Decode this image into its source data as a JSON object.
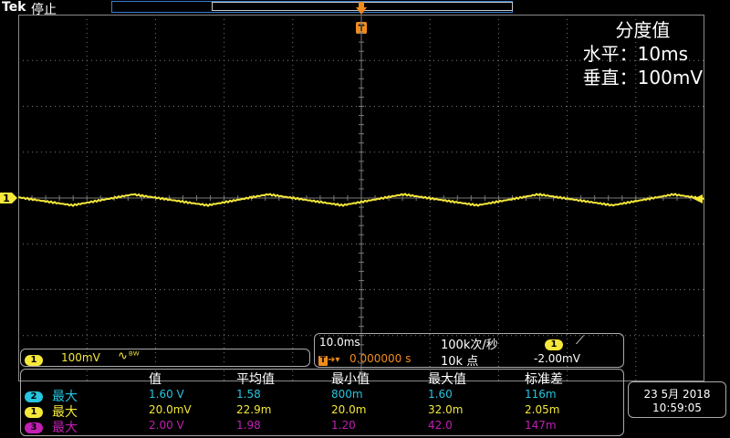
{
  "header": {
    "brand": "Tek",
    "acq_state": "停止"
  },
  "scale_box": {
    "title": "分度值",
    "horizontal_label": "水平：",
    "horizontal_value": "10ms",
    "vertical_label": "垂直：",
    "vertical_value": "100mV"
  },
  "markers": {
    "trigger_letter": "T",
    "channel1": "1"
  },
  "channel_bar": {
    "channel": "1",
    "scale": "100mV",
    "coupling_icon": "∿",
    "bandwidth_icon": "ᴮᵂ"
  },
  "time_bar": {
    "timebase": "10.0ms",
    "sample_rate": "100k次/秒",
    "trigger_channel": "1",
    "trigger_slope": "⟋",
    "trigger_position_icon": "T",
    "trigger_position": "0.000000 s",
    "record_length": "10k 点",
    "trigger_level": "-2.00mV"
  },
  "measurements": {
    "headers": [
      "值",
      "平均值",
      "最小值",
      "最大值",
      "标准差"
    ],
    "rows": [
      {
        "channel": "2",
        "type": "最大",
        "color": "#26c5e0",
        "values": [
          "1.60 V",
          "1.58",
          "800m",
          "1.60",
          "116m"
        ]
      },
      {
        "channel": "1",
        "type": "最大",
        "color": "#f5e83a",
        "values": [
          "20.0mV",
          "22.9m",
          "20.0m",
          "32.0m",
          "2.05m"
        ]
      },
      {
        "channel": "3",
        "type": "最大",
        "color": "#c21fb3",
        "values": [
          "2.00 V",
          "1.98",
          "1.20",
          "42.0",
          "147m"
        ]
      }
    ]
  },
  "clock": {
    "date": "23 5月 2018",
    "time": "10:59:05"
  },
  "colors": {
    "ch1": "#f5e83a",
    "ch2": "#26c5e0",
    "ch3": "#c21fb3",
    "trigger": "#f08c1e",
    "grid": "#8a8a8a"
  }
}
